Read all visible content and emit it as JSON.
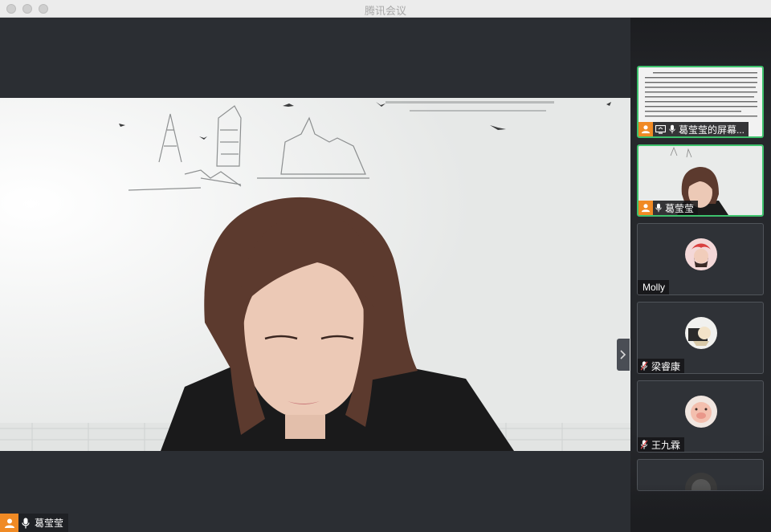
{
  "window": {
    "title": "腾讯会议"
  },
  "main_video": {
    "participant_name": "葛莹莹",
    "badge_icon": "host-user-icon",
    "mic_icon": "mic-on-icon"
  },
  "sidebar": {
    "tiles": [
      {
        "name": "葛莹莹的屏幕...",
        "type": "screen-share",
        "active": true,
        "badge_icon": "host-user-icon",
        "status_icon": "screen-share-icon"
      },
      {
        "name": "葛莹莹",
        "type": "video",
        "active": true,
        "badge_icon": "host-user-icon",
        "mic_icon": "mic-on-icon"
      },
      {
        "name": "Molly",
        "type": "avatar",
        "active": false
      },
      {
        "name": "梁睿康",
        "type": "avatar",
        "active": false,
        "mic_icon": "mic-muted-icon"
      },
      {
        "name": "王九霖",
        "type": "avatar",
        "active": false,
        "mic_icon": "mic-muted-icon"
      }
    ]
  },
  "colors": {
    "host_badge": "#f08a24",
    "active_border": "#3ec26d",
    "muted_mic": "#e04848",
    "background": "#2b2e33"
  }
}
